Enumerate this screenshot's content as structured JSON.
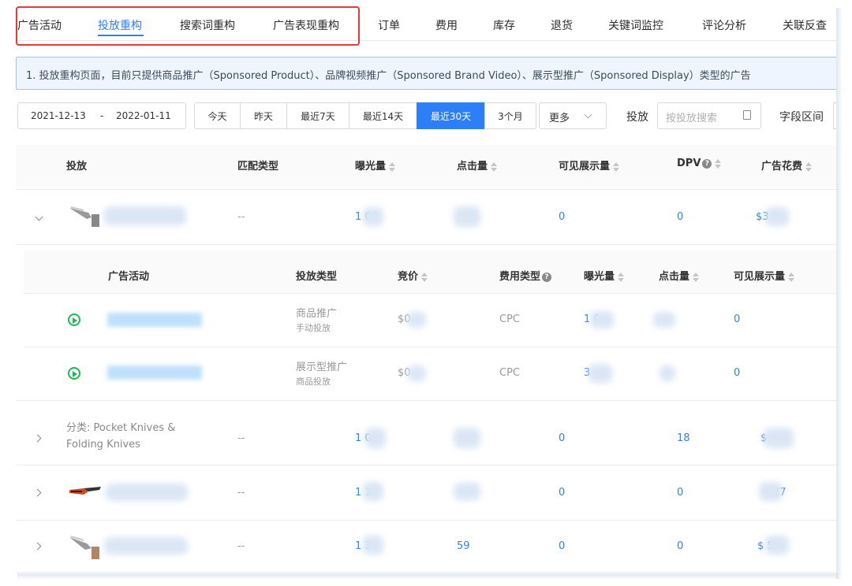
{
  "tabs": [
    {
      "label": "广告活动"
    },
    {
      "label": "投放重构"
    },
    {
      "label": "搜索词重构"
    },
    {
      "label": "广告表现重构"
    },
    {
      "label": "订单"
    },
    {
      "label": "费用"
    },
    {
      "label": "库存"
    },
    {
      "label": "退货"
    },
    {
      "label": "关键词监控"
    },
    {
      "label": "评论分析"
    },
    {
      "label": "关联反查"
    }
  ],
  "notice": "1. 投放重构页面，目前只提供商品推广（Sponsored Product）、品牌视频推广（Sponsored Brand Video）、展示型推广（Sponsored Display）类型的广告",
  "toolbar": {
    "date_start": "2021-12-13",
    "date_sep": "-",
    "date_end": "2022-01-11",
    "ranges": [
      "今天",
      "昨天",
      "最近7天",
      "最近14天",
      "最近30天",
      "3个月"
    ],
    "more": "更多",
    "target_label": "投放",
    "target_placeholder": "按投放搜索",
    "field_label": "字段区间"
  },
  "table": {
    "headers": [
      "投放",
      "匹配类型",
      "曝光量",
      "点击量",
      "可见展示量",
      "DPV",
      "广告花费"
    ],
    "sub_headers": [
      "广告活动",
      "投放类型",
      "竞价",
      "费用类型",
      "曝光量",
      "点击量",
      "可见展示量"
    ],
    "rows": [
      {
        "match": "--",
        "impr": "1  07",
        "views": "0",
        "dpv": "0",
        "spend": "$3  3"
      },
      {
        "match": "--",
        "impr": "1  0",
        "views": "0",
        "dpv": "18",
        "spend": "$"
      },
      {
        "match": "--",
        "impr": "1  1",
        "views": "0",
        "dpv": "0",
        "spend": "27"
      },
      {
        "match": "--",
        "impr": "1  3",
        "clicks": "59",
        "views": "0",
        "dpv": "0",
        "spend": "$  5"
      }
    ],
    "sub_rows": [
      {
        "type": "商品推广",
        "type_sub": "手动投放",
        "bid": "$0",
        "fee": "CPC",
        "impr": "1  0",
        "views": "0"
      },
      {
        "type": "展示型推广",
        "type_sub": "商品投放",
        "bid": "$0",
        "fee": "CPC",
        "impr": "3",
        "views": "0"
      }
    ],
    "category_row": {
      "label": "分类: Pocket Knives & Folding Knives"
    }
  },
  "colors": {
    "accent": "#2d7ff9",
    "highlight_box": "#e53935",
    "active_status": "#1db954"
  }
}
